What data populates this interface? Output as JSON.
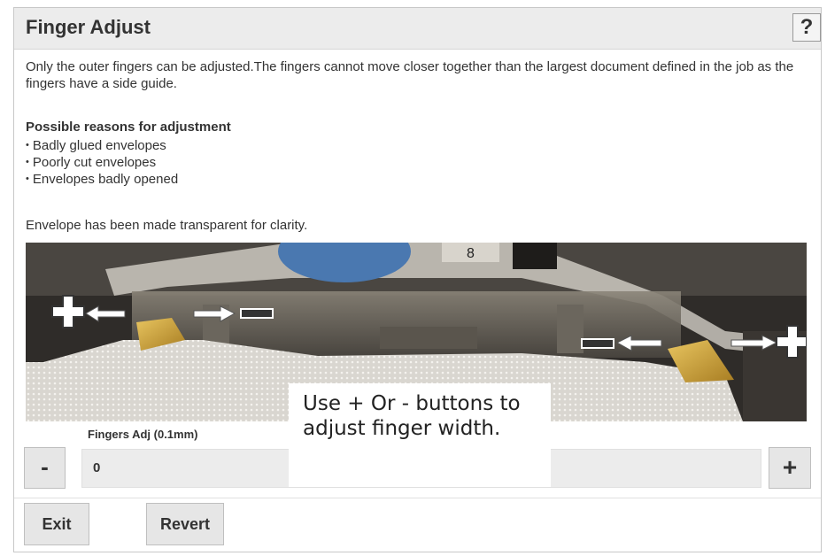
{
  "title": "Finger Adjust",
  "help_label": "?",
  "description": "Only the outer fingers can be adjusted.The fingers cannot move closer together than the largest document defined in the job as the fingers have a side guide.",
  "reasons": {
    "heading": "Possible reasons for adjustment",
    "items": [
      "Badly glued envelopes",
      "Poorly cut envelopes",
      "Envelopes badly opened"
    ]
  },
  "note": "Envelope has been made transparent for clarity.",
  "image": {
    "alt": "Inserter fingers with transparent envelope and adjustment arrows",
    "label_on_part": "8"
  },
  "field": {
    "label": "Fingers Adj (0.1mm)",
    "value": "0"
  },
  "buttons": {
    "minus": "-",
    "plus": "+",
    "exit": "Exit",
    "revert": "Revert"
  },
  "tooltip": "Use + Or - buttons to adjust finger width.",
  "colors": {
    "title_bar": "#ececec",
    "button_bg": "#e6e6e6",
    "input_bg": "#ececec",
    "finger_brass": "#c9a23a"
  }
}
